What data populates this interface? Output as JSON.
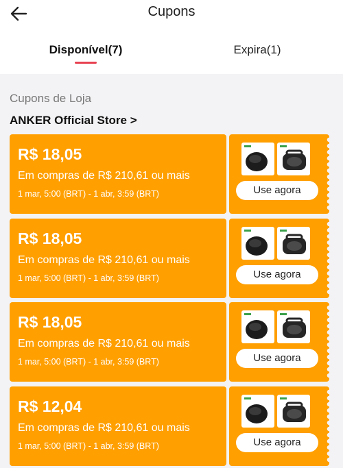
{
  "header": {
    "title": "Cupons",
    "back_icon": "arrow-left-icon"
  },
  "tabs": [
    {
      "label": "Disponível(7)",
      "active": true
    },
    {
      "label": "Expira(1)",
      "active": false
    }
  ],
  "section": {
    "title": "Cupons de Loja",
    "store_link": "ANKER Official Store >"
  },
  "colors": {
    "accent": "#e8404f",
    "coupon_bg": "#ff9f00"
  },
  "coupons": [
    {
      "amount": "R$ 18,05",
      "condition": "Em compras de R$ 210,61 ou mais",
      "validity": "1 mar, 5:00 (BRT) - 1 abr, 3:59 (BRT)",
      "button": "Use agora",
      "product_images": [
        "robot-vacuum-image",
        "bluetooth-speaker-image"
      ]
    },
    {
      "amount": "R$ 18,05",
      "condition": "Em compras de R$ 210,61 ou mais",
      "validity": "1 mar, 5:00 (BRT) - 1 abr, 3:59 (BRT)",
      "button": "Use agora",
      "product_images": [
        "robot-vacuum-image",
        "bluetooth-speaker-image"
      ]
    },
    {
      "amount": "R$ 18,05",
      "condition": "Em compras de R$ 210,61 ou mais",
      "validity": "1 mar, 5:00 (BRT) - 1 abr, 3:59 (BRT)",
      "button": "Use agora",
      "product_images": [
        "robot-vacuum-image",
        "bluetooth-speaker-image"
      ]
    },
    {
      "amount": "R$ 12,04",
      "condition": "Em compras de R$ 210,61 ou mais",
      "validity": "1 mar, 5:00 (BRT) - 1 abr, 3:59 (BRT)",
      "button": "Use agora",
      "product_images": [
        "robot-vacuum-image",
        "bluetooth-speaker-image"
      ]
    }
  ]
}
